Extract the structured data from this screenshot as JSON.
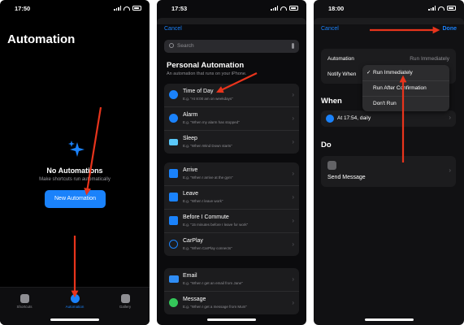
{
  "colors": {
    "accent": "#1a82fb",
    "arrow": "#e8341c"
  },
  "panel1": {
    "time": "17:50",
    "title": "Automation",
    "empty_title": "No Automations",
    "empty_subtitle": "Make shortcuts run automatically",
    "new_button": "New Automation",
    "tabs": [
      {
        "label": "Shortcuts",
        "icon": "layers-icon"
      },
      {
        "label": "Automation",
        "icon": "clock-check-icon"
      },
      {
        "label": "Gallery",
        "icon": "gallery-icon"
      }
    ]
  },
  "panel2": {
    "time": "17:53",
    "cancel": "Cancel",
    "search_placeholder": "Search",
    "heading": "Personal Automation",
    "subheading": "An automation that runs on your iPhone.",
    "group1": [
      {
        "label": "Time of Day",
        "sub": "E.g. \"At 8:00 am on weekdays\""
      },
      {
        "label": "Alarm",
        "sub": "E.g. \"When my alarm has stopped\""
      },
      {
        "label": "Sleep",
        "sub": "E.g. \"When Wind Down starts\""
      }
    ],
    "group2": [
      {
        "label": "Arrive",
        "sub": "E.g. \"When I arrive at the gym\""
      },
      {
        "label": "Leave",
        "sub": "E.g. \"When I leave work\""
      },
      {
        "label": "Before I Commute",
        "sub": "E.g. \"15 minutes before I leave for work\""
      },
      {
        "label": "CarPlay",
        "sub": "E.g. \"When CarPlay connects\""
      }
    ],
    "group3": [
      {
        "label": "Email",
        "sub": "E.g. \"When I get an email from Jane\""
      },
      {
        "label": "Message",
        "sub": "E.g. \"When I get a message from Mum\""
      }
    ]
  },
  "panel3": {
    "time": "18:00",
    "cancel": "Cancel",
    "done": "Done",
    "automation_label": "Automation",
    "automation_value": "Run Immediately",
    "notify_label": "Notify When",
    "menu": [
      {
        "check": "✓",
        "label": "Run Immediately"
      },
      {
        "check": "",
        "label": "Run After Confirmation"
      },
      {
        "check": "",
        "label": "Don't Run"
      }
    ],
    "when_heading": "When",
    "when_value": "At 17:54, daily",
    "do_heading": "Do",
    "do_value": "Send Message"
  }
}
